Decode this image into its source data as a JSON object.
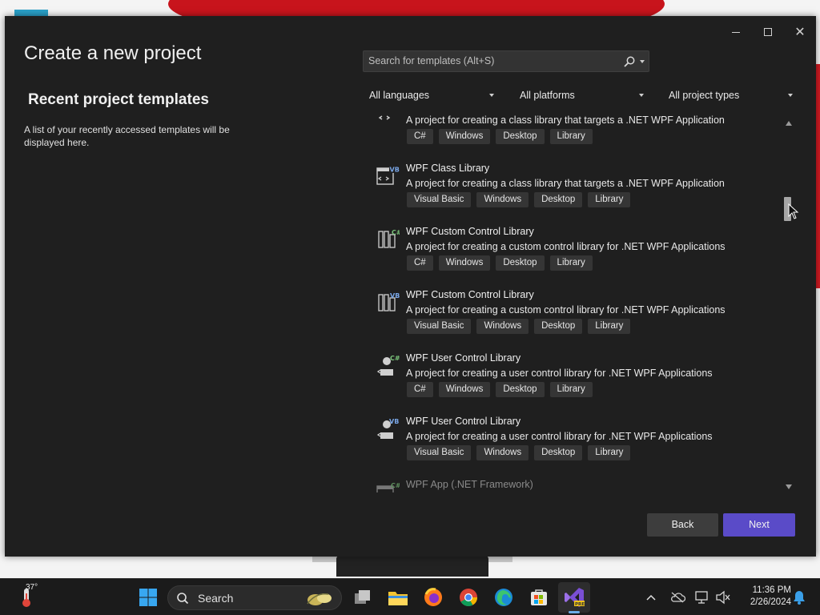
{
  "window": {
    "title": "Create a new project",
    "controls": {
      "minimize": "minimize",
      "maximize": "maximize",
      "close": "✕"
    }
  },
  "recent": {
    "title": "Recent project templates",
    "description": "A list of your recently accessed templates will be displayed here."
  },
  "search": {
    "placeholder": "Search for templates (Alt+S)"
  },
  "filters": {
    "language": "All languages",
    "platform": "All platforms",
    "project_type": "All project types"
  },
  "templates": [
    {
      "name": "",
      "description": "A project for creating a class library that targets a .NET WPF Application",
      "tags": [
        "C#",
        "Windows",
        "Desktop",
        "Library"
      ],
      "icon": "wpf-class-library-csharp-icon"
    },
    {
      "name": "WPF Class Library",
      "description": "A project for creating a class library that targets a .NET WPF Application",
      "tags": [
        "Visual Basic",
        "Windows",
        "Desktop",
        "Library"
      ],
      "icon": "wpf-class-library-vb-icon"
    },
    {
      "name": "WPF Custom Control Library",
      "description": "A project for creating a custom control library for .NET WPF Applications",
      "tags": [
        "C#",
        "Windows",
        "Desktop",
        "Library"
      ],
      "icon": "wpf-custom-control-csharp-icon"
    },
    {
      "name": "WPF Custom Control Library",
      "description": "A project for creating a custom control library for .NET WPF Applications",
      "tags": [
        "Visual Basic",
        "Windows",
        "Desktop",
        "Library"
      ],
      "icon": "wpf-custom-control-vb-icon"
    },
    {
      "name": "WPF User Control Library",
      "description": "A project for creating a user control library for .NET WPF Applications",
      "tags": [
        "C#",
        "Windows",
        "Desktop",
        "Library"
      ],
      "icon": "wpf-user-control-csharp-icon"
    },
    {
      "name": "WPF User Control Library",
      "description": "A project for creating a user control library for .NET WPF Applications",
      "tags": [
        "Visual Basic",
        "Windows",
        "Desktop",
        "Library"
      ],
      "icon": "wpf-user-control-vb-icon"
    },
    {
      "name": "WPF App (.NET Framework)",
      "description": "",
      "tags": [],
      "icon": "wpf-app-framework-icon"
    }
  ],
  "buttons": {
    "back": "Back",
    "next": "Next"
  },
  "taskbar": {
    "weather_temp": "37°",
    "search_label": "Search",
    "time": "11:36 PM",
    "date": "2/26/2024"
  },
  "colors": {
    "dialog_bg": "#1f1f1f",
    "tag_bg": "#353535",
    "accent": "#5a4bc8",
    "taskbar_bg": "#1b1b1b"
  }
}
